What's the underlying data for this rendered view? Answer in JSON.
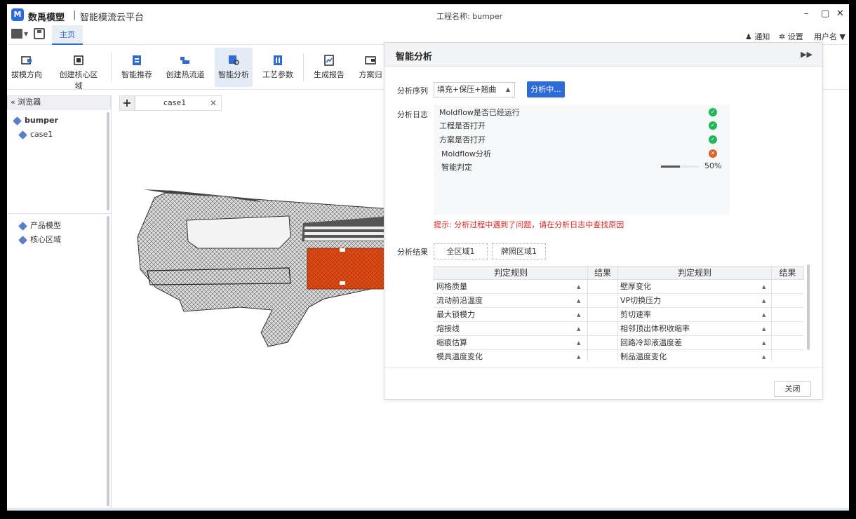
{
  "app": {
    "brand": "数禹模塑",
    "separator": "|",
    "subtitle": "智能模流云平台",
    "project_title": "工程名称: bumper",
    "window_controls": {
      "minimize": "–",
      "restore": "▢",
      "close": "✕"
    }
  },
  "menu": {
    "home_tab": "主页",
    "notify": "通知",
    "settings": "设置",
    "user": "用户名 ▼"
  },
  "toolbar": [
    {
      "label": "拔模方向",
      "icon": "draft-direction-icon"
    },
    {
      "label": "创建核心区域",
      "icon": "core-region-icon"
    },
    {
      "label": "智能推荐",
      "icon": "smart-recommend-icon"
    },
    {
      "label": "创建热流道",
      "icon": "hot-runner-icon"
    },
    {
      "label": "智能分析",
      "icon": "smart-analysis-icon"
    },
    {
      "label": "工艺参数",
      "icon": "process-params-icon"
    },
    {
      "label": "生成报告",
      "icon": "report-icon"
    },
    {
      "label": "方案归",
      "icon": "plan-archive-icon"
    }
  ],
  "browser": {
    "title": "浏览器",
    "root": "bumper",
    "case": "case1",
    "model_items": [
      "产品模型",
      "核心区域"
    ]
  },
  "tabs": {
    "case_tab": "case1"
  },
  "analysis_panel": {
    "title": "智能分析",
    "seq_label": "分析序列",
    "seq_value": "填充+保压+翘曲",
    "run_button": "分析中...",
    "log_label": "分析日志",
    "log": [
      {
        "text": "Moldflow是否已经运行",
        "status": "ok"
      },
      {
        "text": "工程是否打开",
        "status": "ok"
      },
      {
        "text": "方案是否打开",
        "status": "ok"
      },
      {
        "text": "Moldflow分析",
        "status": "error"
      },
      {
        "text": "智能判定",
        "status": "progress"
      }
    ],
    "progress_value": 50,
    "progress_text": "50%",
    "hint": "提示: 分析过程中遇到了问题，请在分析日志中查找原因",
    "result_label": "分析结果",
    "regions": [
      "全区域1",
      "牌照区域1"
    ],
    "table": {
      "headers": [
        "判定规则",
        "结果",
        "判定规则",
        "结果"
      ],
      "left_rules": [
        "网格质量",
        "流动前沿温度",
        "最大锁模力",
        "熔接线",
        "缩痕估算",
        "模具温度变化"
      ],
      "right_rules": [
        "壁厚变化",
        "VP切换压力",
        "剪切速率",
        "相邻顶出体积收缩率",
        "回路冷却液温度差",
        "制品温度变化"
      ]
    },
    "close_button": "关闭"
  },
  "colors": {
    "accent": "#2f6bd6",
    "ok": "#1db954",
    "error": "#e0602a",
    "hint": "#e02020",
    "highlight_region": "#e04a14"
  }
}
